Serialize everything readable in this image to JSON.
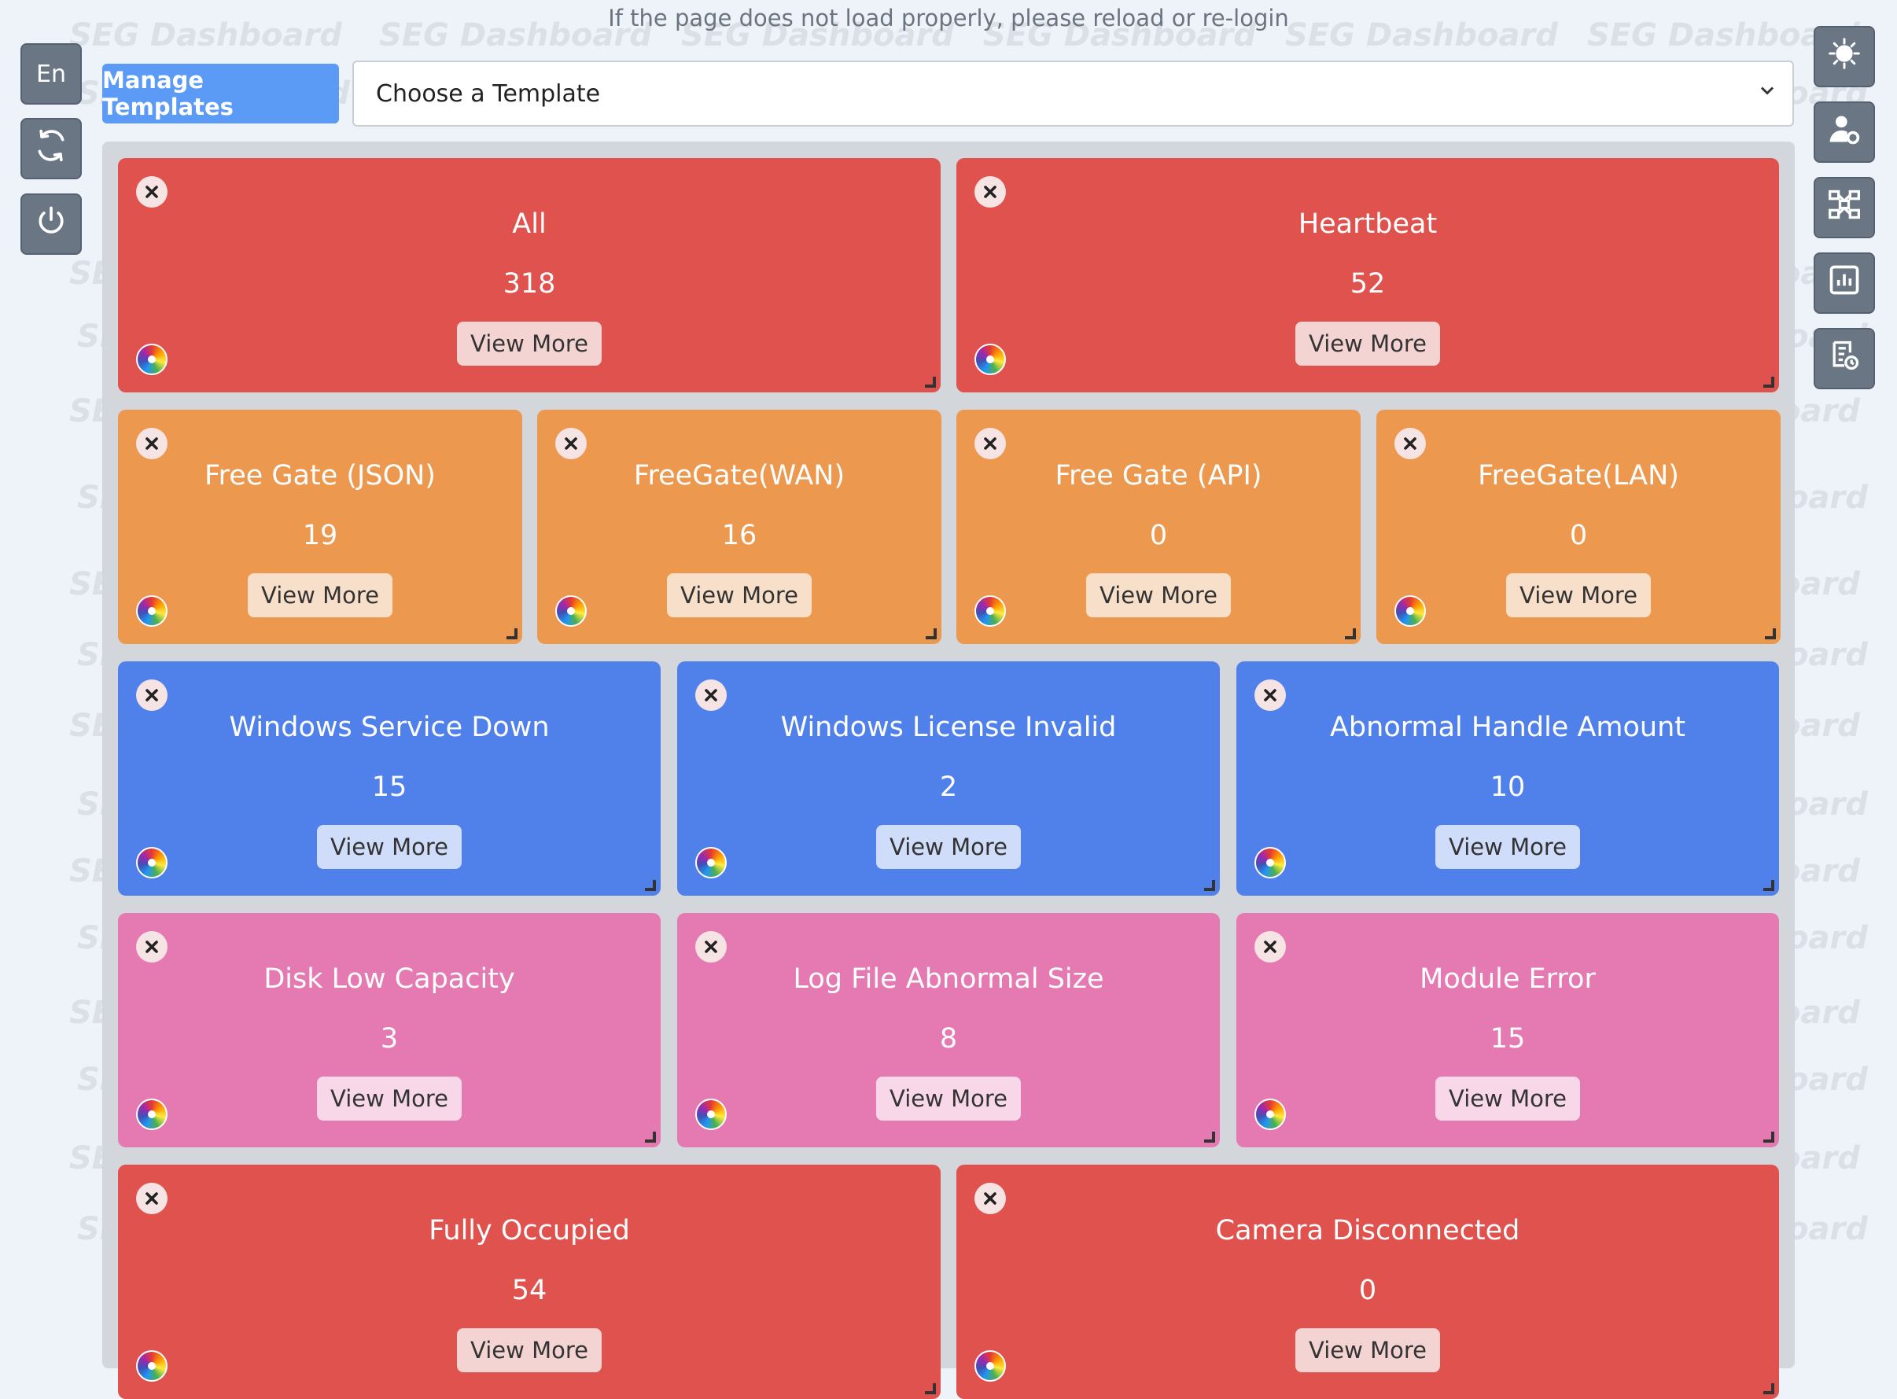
{
  "notice": "If the page does not load properly, please reload or re-login",
  "watermark_text": "SEG Dashboard",
  "left_toolbar": {
    "language": "En",
    "refresh_icon": "refresh-icon",
    "power_icon": "power-icon"
  },
  "right_toolbar": {
    "icons": [
      "bug-icon",
      "user-settings-icon",
      "network-icon",
      "report-chart-icon",
      "log-settings-icon"
    ]
  },
  "templates": {
    "manage_label": "Manage Templates",
    "select_value": "Choose a Template"
  },
  "colors": {
    "red": "#df524d",
    "orange": "#ec984e",
    "blue": "#5081ea",
    "pink": "#e57ab2",
    "accent": "#5b9bf5"
  },
  "tiles": [
    {
      "title": "All",
      "count": "318",
      "button": "View More",
      "color": "red"
    },
    {
      "title": "Heartbeat",
      "count": "52",
      "button": "View More",
      "color": "red"
    },
    {
      "title": "Free Gate (JSON)",
      "count": "19",
      "button": "View More",
      "color": "orange"
    },
    {
      "title": "FreeGate(WAN)",
      "count": "16",
      "button": "View More",
      "color": "orange"
    },
    {
      "title": "Free Gate (API)",
      "count": "0",
      "button": "View More",
      "color": "orange"
    },
    {
      "title": "FreeGate(LAN)",
      "count": "0",
      "button": "View More",
      "color": "orange"
    },
    {
      "title": "Windows Service Down",
      "count": "15",
      "button": "View More",
      "color": "blue"
    },
    {
      "title": "Windows License Invalid",
      "count": "2",
      "button": "View More",
      "color": "blue"
    },
    {
      "title": "Abnormal Handle Amount",
      "count": "10",
      "button": "View More",
      "color": "blue"
    },
    {
      "title": "Disk Low Capacity",
      "count": "3",
      "button": "View More",
      "color": "pink"
    },
    {
      "title": "Log File Abnormal Size",
      "count": "8",
      "button": "View More",
      "color": "pink"
    },
    {
      "title": "Module Error",
      "count": "15",
      "button": "View More",
      "color": "pink"
    },
    {
      "title": "Fully Occupied",
      "count": "54",
      "button": "View More",
      "color": "red"
    },
    {
      "title": "Camera Disconnected",
      "count": "0",
      "button": "View More",
      "color": "red"
    }
  ]
}
